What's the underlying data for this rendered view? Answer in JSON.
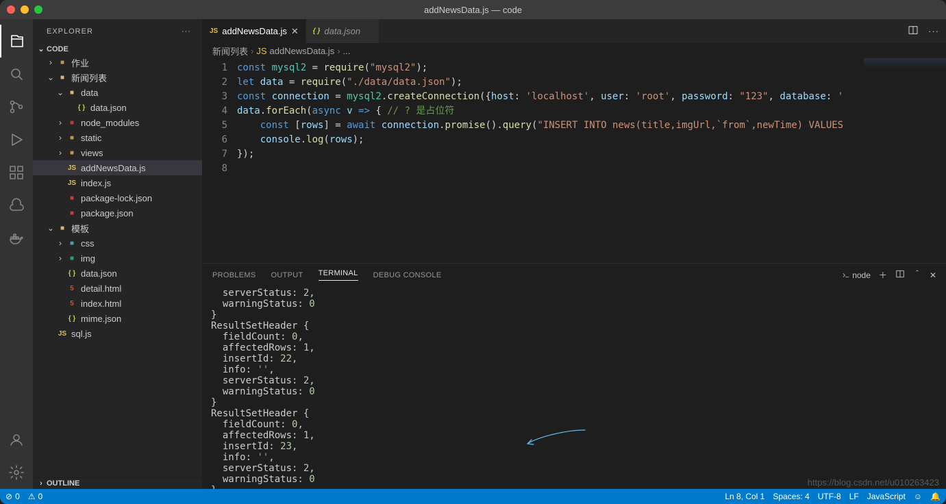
{
  "window": {
    "title": "addNewsData.js — code"
  },
  "sidebar": {
    "header": "EXPLORER",
    "root": "CODE",
    "outline": "OUTLINE",
    "tree": [
      {
        "d": 1,
        "tw": "›",
        "ico": "folder",
        "cls": "ico-folder",
        "label": "作业"
      },
      {
        "d": 1,
        "tw": "⌄",
        "ico": "folder",
        "cls": "ico-folder-open",
        "label": "新闻列表"
      },
      {
        "d": 2,
        "tw": "⌄",
        "ico": "folder",
        "cls": "ico-folder-open",
        "label": "data"
      },
      {
        "d": 3,
        "tw": "",
        "ico": "json",
        "cls": "ico-json",
        "label": "data.json"
      },
      {
        "d": 2,
        "tw": "›",
        "ico": "folder",
        "cls": "ico-npm",
        "label": "node_modules"
      },
      {
        "d": 2,
        "tw": "›",
        "ico": "folder",
        "cls": "ico-folder",
        "label": "static"
      },
      {
        "d": 2,
        "tw": "›",
        "ico": "folder",
        "cls": "ico-folder",
        "label": "views"
      },
      {
        "d": 2,
        "tw": "",
        "ico": "js",
        "cls": "ico-js",
        "label": "addNewsData.js",
        "selected": true
      },
      {
        "d": 2,
        "tw": "",
        "ico": "js",
        "cls": "ico-js",
        "label": "index.js"
      },
      {
        "d": 2,
        "tw": "",
        "ico": "npm",
        "cls": "ico-npm",
        "label": "package-lock.json"
      },
      {
        "d": 2,
        "tw": "",
        "ico": "npm",
        "cls": "ico-npm",
        "label": "package.json"
      },
      {
        "d": 1,
        "tw": "⌄",
        "ico": "folder",
        "cls": "ico-folder-open",
        "label": "模板"
      },
      {
        "d": 2,
        "tw": "›",
        "ico": "folder",
        "cls": "ico-css",
        "label": "css"
      },
      {
        "d": 2,
        "tw": "›",
        "ico": "folder",
        "cls": "ico-img",
        "label": "img"
      },
      {
        "d": 2,
        "tw": "",
        "ico": "json",
        "cls": "ico-json",
        "label": "data.json"
      },
      {
        "d": 2,
        "tw": "",
        "ico": "html",
        "cls": "ico-html",
        "label": "detail.html"
      },
      {
        "d": 2,
        "tw": "",
        "ico": "html",
        "cls": "ico-html",
        "label": "index.html"
      },
      {
        "d": 2,
        "tw": "",
        "ico": "json",
        "cls": "ico-json",
        "label": "mime.json"
      },
      {
        "d": 1,
        "tw": "",
        "ico": "js",
        "cls": "ico-js",
        "label": "sql.js"
      }
    ]
  },
  "tabs": [
    {
      "icon": "js",
      "cls": "ico-js",
      "label": "addNewsData.js",
      "active": true
    },
    {
      "icon": "json",
      "cls": "ico-json",
      "label": "data.json",
      "active": false
    }
  ],
  "breadcrumb": {
    "p1": "新闻列表",
    "p2": "addNewsData.js",
    "p3": "..."
  },
  "code": {
    "lines": [
      [
        {
          "t": "const ",
          "c": "kw"
        },
        {
          "t": "mysql2",
          "c": "type"
        },
        {
          "t": " = ",
          "c": "op"
        },
        {
          "t": "require",
          "c": "fn"
        },
        {
          "t": "(",
          "c": "pun"
        },
        {
          "t": "\"mysql2\"",
          "c": "str"
        },
        {
          "t": ");",
          "c": "pun"
        }
      ],
      [
        {
          "t": "let ",
          "c": "kw"
        },
        {
          "t": "data",
          "c": "var"
        },
        {
          "t": " = ",
          "c": "op"
        },
        {
          "t": "require",
          "c": "fn"
        },
        {
          "t": "(",
          "c": "pun"
        },
        {
          "t": "\"./data/data.json\"",
          "c": "str"
        },
        {
          "t": ");",
          "c": "pun"
        }
      ],
      [
        {
          "t": "const ",
          "c": "kw"
        },
        {
          "t": "connection",
          "c": "var"
        },
        {
          "t": " = ",
          "c": "op"
        },
        {
          "t": "mysql2",
          "c": "type"
        },
        {
          "t": ".",
          "c": "pun"
        },
        {
          "t": "createConnection",
          "c": "fn"
        },
        {
          "t": "({",
          "c": "pun"
        },
        {
          "t": "host",
          "c": "prop"
        },
        {
          "t": ": ",
          "c": "pun"
        },
        {
          "t": "'localhost'",
          "c": "str"
        },
        {
          "t": ", ",
          "c": "pun"
        },
        {
          "t": "user",
          "c": "prop"
        },
        {
          "t": ": ",
          "c": "pun"
        },
        {
          "t": "'root'",
          "c": "str"
        },
        {
          "t": ", ",
          "c": "pun"
        },
        {
          "t": "password",
          "c": "prop"
        },
        {
          "t": ": ",
          "c": "pun"
        },
        {
          "t": "\"123\"",
          "c": "str"
        },
        {
          "t": ", ",
          "c": "pun"
        },
        {
          "t": "database",
          "c": "prop"
        },
        {
          "t": ": ",
          "c": "pun"
        },
        {
          "t": "'",
          "c": "str"
        }
      ],
      [
        {
          "t": "data",
          "c": "var"
        },
        {
          "t": ".",
          "c": "pun"
        },
        {
          "t": "forEach",
          "c": "fn"
        },
        {
          "t": "(",
          "c": "pun"
        },
        {
          "t": "async ",
          "c": "kw"
        },
        {
          "t": "v",
          "c": "var"
        },
        {
          "t": " => ",
          "c": "kw"
        },
        {
          "t": "{ ",
          "c": "pun"
        },
        {
          "t": "// ? 是占位符",
          "c": "cm"
        }
      ],
      [
        {
          "t": "    ",
          "c": "pun"
        },
        {
          "t": "const ",
          "c": "kw"
        },
        {
          "t": "[",
          "c": "pun"
        },
        {
          "t": "rows",
          "c": "var"
        },
        {
          "t": "] = ",
          "c": "pun"
        },
        {
          "t": "await ",
          "c": "kw"
        },
        {
          "t": "connection",
          "c": "var"
        },
        {
          "t": ".",
          "c": "pun"
        },
        {
          "t": "promise",
          "c": "fn"
        },
        {
          "t": "().",
          "c": "pun"
        },
        {
          "t": "query",
          "c": "fn"
        },
        {
          "t": "(",
          "c": "pun"
        },
        {
          "t": "\"INSERT INTO news(title,imgUrl,`from`,newTime) VALUES",
          "c": "str"
        }
      ],
      [
        {
          "t": "    ",
          "c": "pun"
        },
        {
          "t": "console",
          "c": "var"
        },
        {
          "t": ".",
          "c": "pun"
        },
        {
          "t": "log",
          "c": "fn"
        },
        {
          "t": "(",
          "c": "pun"
        },
        {
          "t": "rows",
          "c": "var"
        },
        {
          "t": ");",
          "c": "pun"
        }
      ],
      [
        {
          "t": "});",
          "c": "pun"
        }
      ],
      [
        {
          "t": "",
          "c": "pun"
        }
      ]
    ]
  },
  "panel": {
    "tabs": [
      "PROBLEMS",
      "OUTPUT",
      "TERMINAL",
      "DEBUG CONSOLE"
    ],
    "activeTab": 2,
    "shell": "node",
    "output": "  serverStatus: 2,\n  warningStatus: 0\n}\nResultSetHeader {\n  fieldCount: 0,\n  affectedRows: 1,\n  insertId: 22,\n  info: '',\n  serverStatus: 2,\n  warningStatus: 0\n}\nResultSetHeader {\n  fieldCount: 0,\n  affectedRows: 1,\n  insertId: 23,\n  info: '',\n  serverStatus: 2,\n  warningStatus: 0\n}\n▮"
  },
  "statusbar": {
    "errors": "0",
    "warnings": "0",
    "pos": "Ln 8, Col 1",
    "spaces": "Spaces: 4",
    "enc": "UTF-8",
    "eol": "LF",
    "lang": "JavaScript"
  },
  "watermark": "https://blog.csdn.net/u010263423"
}
